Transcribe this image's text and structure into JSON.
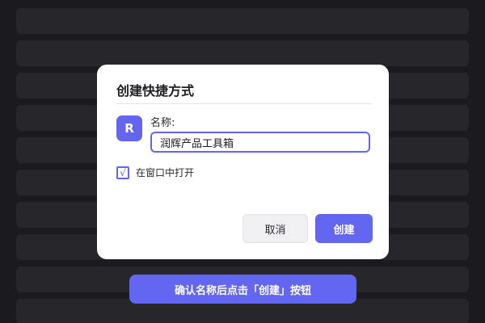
{
  "dialog": {
    "title": "创建快捷方式",
    "app_icon_letter": "R",
    "name_label": "名称:",
    "name_value": "润辉产品工具箱",
    "checkbox_label": "在窗口中打开",
    "checkbox_checked": true,
    "checkbox_mark": "√",
    "cancel_label": "取消",
    "create_label": "创建"
  },
  "hint": {
    "text": "确认名称后点击「创建」按钮"
  },
  "colors": {
    "accent": "#6366f1",
    "backdrop": "#1b1b1f",
    "row": "#26262b"
  }
}
